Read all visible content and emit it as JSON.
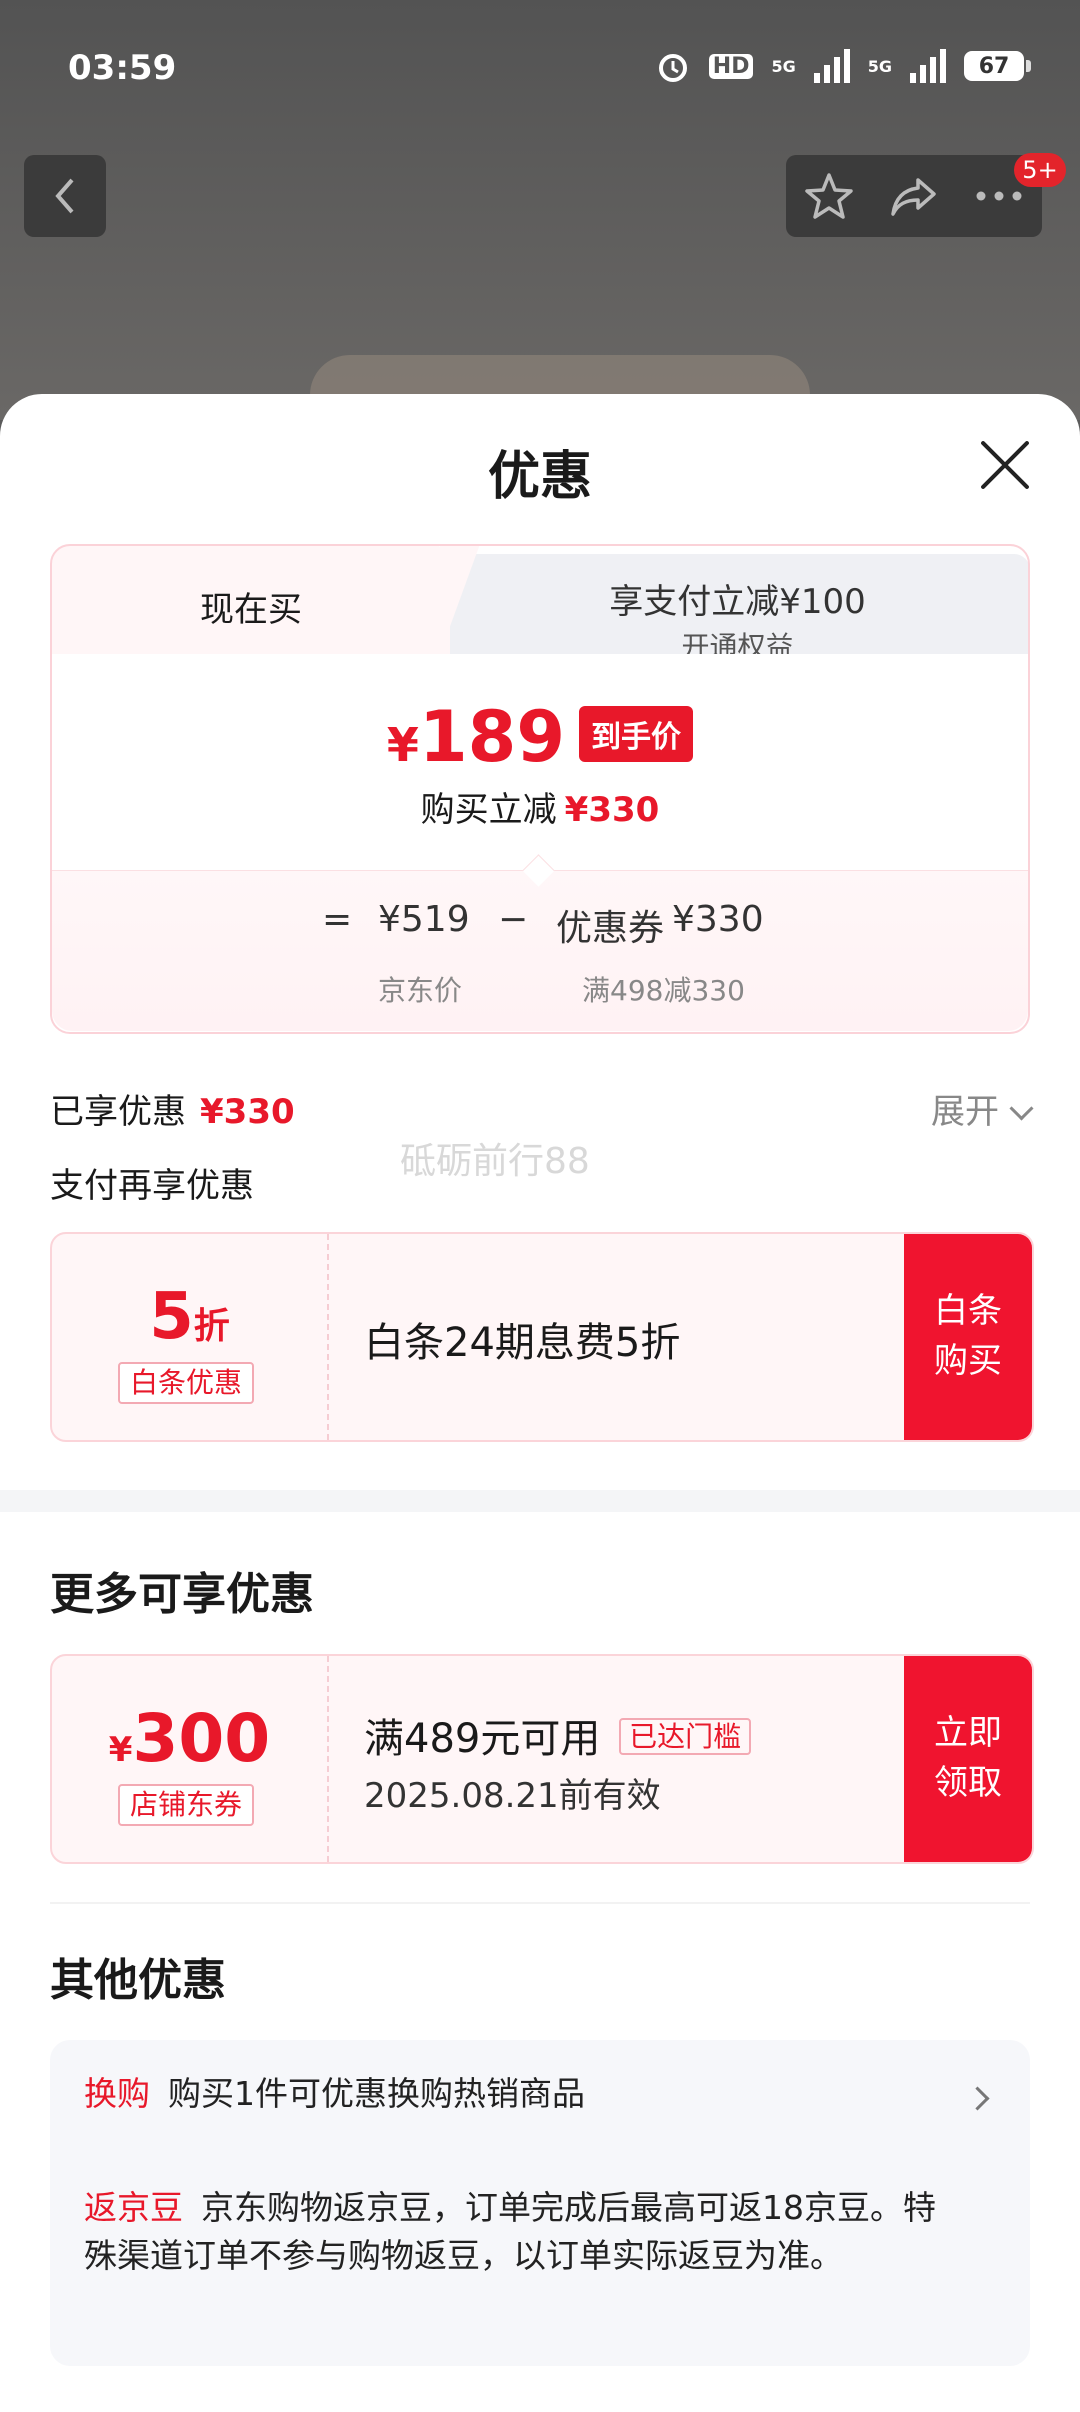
{
  "status_bar": {
    "time": "03:59",
    "hd_label": "HD",
    "net1": "5G",
    "net2": "5G",
    "battery": "67"
  },
  "nav": {
    "badge": "5+",
    "icons": [
      "back-icon",
      "star-icon",
      "share-icon",
      "more-icon"
    ]
  },
  "sheet": {
    "title": "优惠"
  },
  "price_card": {
    "tab_now": "现在买",
    "tab_alt_title": "享支付立减¥100",
    "tab_alt_sub": "开通权益",
    "final_yen": "¥",
    "final_price": "189",
    "final_tag": "到手价",
    "saving_label": "购买立减",
    "saving_value": "¥330",
    "formula": {
      "eq": "=",
      "orig_price": "¥519",
      "minus": "−",
      "coupon_label": "优惠券",
      "coupon_value": "¥330",
      "orig_label": "京东价",
      "coupon_rule": "满498减330"
    }
  },
  "enjoyed": {
    "label": "已享优惠",
    "value": "¥330",
    "expand": "展开"
  },
  "pay_more": {
    "title": "支付再享优惠",
    "watermark": "砥砺前行88"
  },
  "baitiao_coupon": {
    "discount_num": "5",
    "discount_unit": "折",
    "label": "白条优惠",
    "desc": "白条24期息费5折",
    "cta_line1": "白条",
    "cta_line2": "购买"
  },
  "more_section": {
    "title": "更多可享优惠"
  },
  "shop_coupon": {
    "yen": "¥",
    "amount": "300",
    "label": "店铺东券",
    "condition": "满489元可用",
    "status_tag": "已达门槛",
    "expiry": "2025.08.21前有效",
    "cta_line1": "立即",
    "cta_line2": "领取"
  },
  "other_section": {
    "title": "其他优惠",
    "items": [
      {
        "tag": "换购",
        "text": "购买1件可优惠换购热销商品"
      },
      {
        "tag": "返京豆",
        "text": "京东购物返京豆，订单完成后最高可返18京豆。特殊渠道订单不参与购物返豆，以订单实际返豆为准。"
      }
    ]
  },
  "colors": {
    "accent_red": "#e8182a",
    "cta_red": "#f0142f",
    "pink_bg": "#fff6f7"
  }
}
